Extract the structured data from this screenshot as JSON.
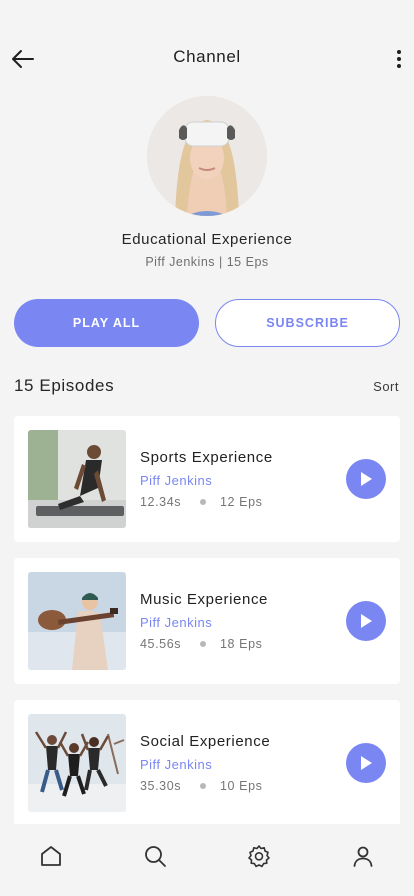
{
  "header": {
    "title": "Channel",
    "back_icon": "back-arrow-icon",
    "more_icon": "more-vertical-icon"
  },
  "channel": {
    "name": "Educational Experience",
    "meta": "Piff Jenkins | 15 Eps",
    "avatar": "vr-headset-woman-avatar"
  },
  "actions": {
    "play_all": "PLAY ALL",
    "subscribe": "SUBSCRIBE"
  },
  "episodes_section": {
    "title": "15 Episodes",
    "sort": "Sort"
  },
  "episodes": [
    {
      "title": "Sports Experience",
      "author": "Piff Jenkins",
      "duration": "12.34s",
      "eps": "12 Eps",
      "thumb": "yoga-man-thumbnail"
    },
    {
      "title": "Music Experience",
      "author": "Piff Jenkins",
      "duration": "45.56s",
      "eps": "18 Eps",
      "thumb": "guitar-woman-thumbnail"
    },
    {
      "title": "Social Experience",
      "author": "Piff Jenkins",
      "duration": "35.30s",
      "eps": "10 Eps",
      "thumb": "friends-jumping-thumbnail"
    }
  ],
  "tabbar": {
    "items": [
      "home-icon",
      "search-icon",
      "settings-icon",
      "profile-icon"
    ]
  },
  "colors": {
    "accent": "#7a86f2",
    "background": "#f4f4f4",
    "card": "#ffffff"
  }
}
